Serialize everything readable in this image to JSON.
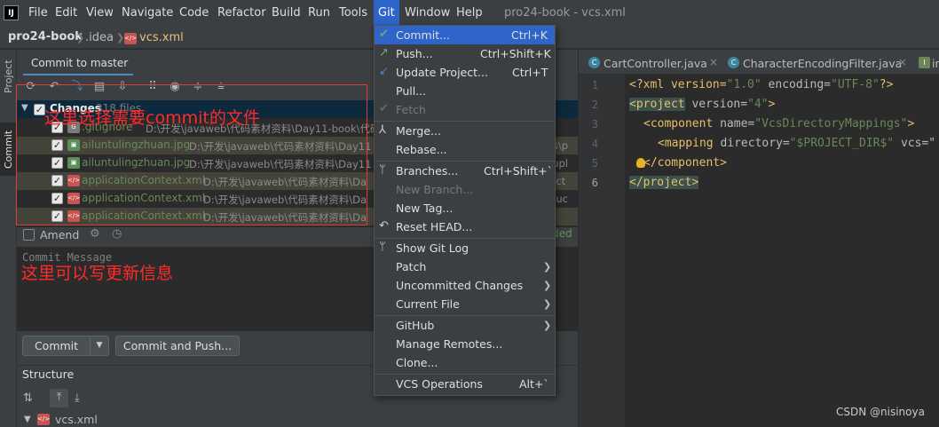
{
  "menubar": {
    "items": [
      "File",
      "Edit",
      "View",
      "Navigate",
      "Code",
      "Refactor",
      "Build",
      "Run",
      "Tools",
      "Git",
      "Window",
      "Help"
    ],
    "title": "pro24-book - vcs.xml"
  },
  "navbar": {
    "project": "pro24-book",
    "folder": ".idea",
    "file": "vcs.xml"
  },
  "left_strip": {
    "project_tab": "Project",
    "commit_tab": "Commit"
  },
  "commit_panel": {
    "header": "Commit to master",
    "changes_label": "Changes",
    "changes_count": "318 files",
    "files": [
      {
        "name": ".gitignore",
        "path": "D:\\开发\\javaweb\\代码素材资料\\Day11-book\\代码",
        "color": "#6a8759",
        "icon": "git-icon"
      },
      {
        "name": "ailuntulingzhuan.jpg",
        "path": "D:\\开发\\javaweb\\代码素材资料\\Day11",
        "color": "#6a8759",
        "icon": "image-icon"
      },
      {
        "name": "ailuntulingzhuan.jpg",
        "path": "D:\\开发\\javaweb\\代码素材资料\\Day11",
        "color": "#6a8759",
        "icon": "image-icon"
      },
      {
        "name": "applicationContext.xml",
        "path": "D:\\开发\\javaweb\\代码素材资料\\Da",
        "color": "#6a8759",
        "icon": "xml-icon"
      },
      {
        "name": "applicationContext.xml",
        "path": "D:\\开发\\javaweb\\代码素材资料\\Da",
        "color": "#6a8759",
        "icon": "xml-icon"
      },
      {
        "name": "applicationContext.xml",
        "path": "D:\\开发\\javaweb\\代码素材资料\\Da",
        "color": "#6a8759",
        "icon": "xml-icon"
      }
    ],
    "right_fragments": [
      "cts\\p",
      "c\\upl",
      "ifact",
      "oduc",
      ""
    ],
    "annotation_files": "这里选择需要commit的文件",
    "amend_label": "Amend",
    "message_placeholder": "Commit Message",
    "annotation_message": "这里可以写更新信息",
    "commit_button": "Commit",
    "commit_push_button": "Commit and Push...",
    "ghost_text": "ded"
  },
  "structure": {
    "title": "Structure",
    "file": "vcs.xml"
  },
  "editor": {
    "tabs": [
      "CartController.java",
      "CharacterEncodingFilter.java",
      "in"
    ],
    "line_numbers": [
      "1",
      "2",
      "3",
      "4",
      "5",
      "6"
    ],
    "lines": {
      "l1": {
        "a": "<?xml version=",
        "b": "\"1.0\"",
        "c": " encoding=",
        "d": "\"UTF-8\"",
        "e": "?>"
      },
      "l2": {
        "a": "<project",
        "b": " version=",
        "c": "\"4\"",
        "d": ">"
      },
      "l3": {
        "a": "<component",
        "b": " name=",
        "c": "\"VcsDirectoryMappings\"",
        "d": ">"
      },
      "l4": {
        "a": "<mapping",
        "b": " directory=",
        "c": "\"$PROJECT_DIR$\"",
        "d": " vcs=\""
      },
      "l5": {
        "a": "</component>"
      },
      "l6": {
        "a": "</project>"
      }
    }
  },
  "git_menu": {
    "items": [
      {
        "label": "Commit...",
        "shortcut": "Ctrl+K"
      },
      {
        "label": "Push...",
        "shortcut": "Ctrl+Shift+K"
      },
      {
        "label": "Update Project...",
        "shortcut": "Ctrl+T"
      },
      {
        "label": "Pull...",
        "shortcut": ""
      },
      {
        "label": "Fetch",
        "shortcut": ""
      },
      {
        "label": "Merge...",
        "shortcut": ""
      },
      {
        "label": "Rebase...",
        "shortcut": ""
      },
      {
        "label": "Branches...",
        "shortcut": "Ctrl+Shift+`"
      },
      {
        "label": "New Branch...",
        "shortcut": ""
      },
      {
        "label": "New Tag...",
        "shortcut": ""
      },
      {
        "label": "Reset HEAD...",
        "shortcut": ""
      },
      {
        "label": "Show Git Log",
        "shortcut": ""
      },
      {
        "label": "Patch",
        "shortcut": ""
      },
      {
        "label": "Uncommitted Changes",
        "shortcut": ""
      },
      {
        "label": "Current File",
        "shortcut": ""
      },
      {
        "label": "GitHub",
        "shortcut": ""
      },
      {
        "label": "Manage Remotes...",
        "shortcut": ""
      },
      {
        "label": "Clone...",
        "shortcut": ""
      },
      {
        "label": "VCS Operations",
        "shortcut": "Alt+`"
      }
    ]
  },
  "watermark": "CSDN @nisinoya",
  "colors": {
    "accent": "#2f65ca",
    "annotation": "#ff2b2b",
    "added_file": "#6a8759"
  }
}
